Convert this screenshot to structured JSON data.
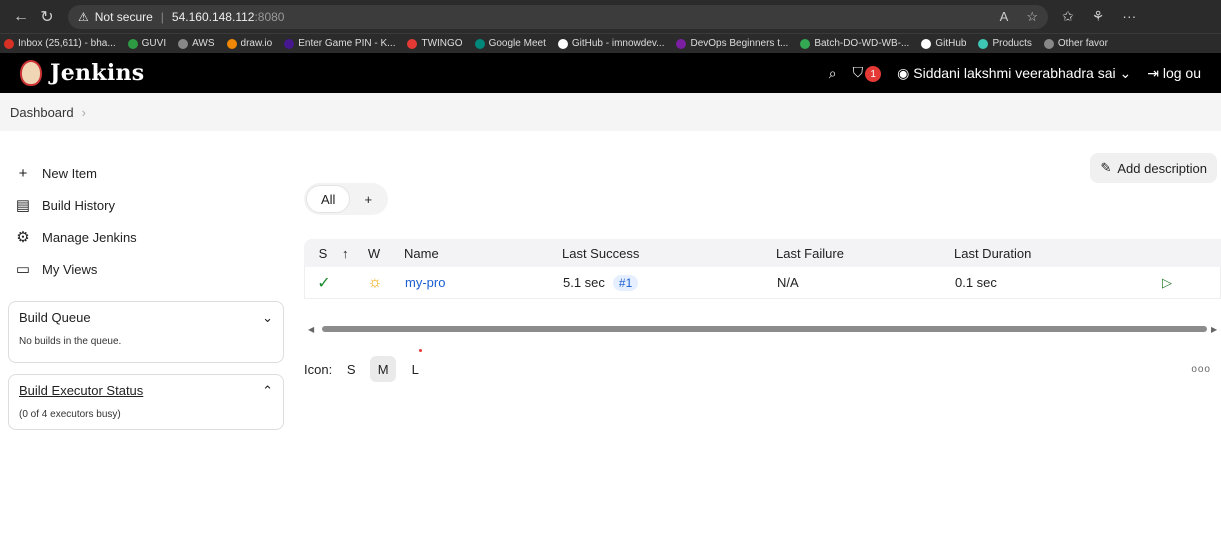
{
  "browser": {
    "warning": "Not secure",
    "url_host": "54.160.148.112",
    "url_port": ":8080"
  },
  "bookmarks": [
    {
      "label": "Inbox (25,611) - bha...",
      "color": "#d93025"
    },
    {
      "label": "GUVI",
      "color": "#2e9b44"
    },
    {
      "label": "AWS",
      "color": "#888888"
    },
    {
      "label": "draw.io",
      "color": "#f08705"
    },
    {
      "label": "Enter Game PIN - K...",
      "color": "#46178f"
    },
    {
      "label": "TWINGO",
      "color": "#e53935"
    },
    {
      "label": "Google Meet",
      "color": "#00897b"
    },
    {
      "label": "GitHub - imnowdev...",
      "color": "#ffffff"
    },
    {
      "label": "DevOps Beginners t...",
      "color": "#7b1fa2"
    },
    {
      "label": "Batch-DO-WD-WB-...",
      "color": "#34a853"
    },
    {
      "label": "GitHub",
      "color": "#ffffff"
    },
    {
      "label": "Products",
      "color": "#3ec6b5"
    },
    {
      "label": "Other favor",
      "color": "#888888"
    }
  ],
  "header": {
    "title": "Jenkins",
    "notification_count": "1",
    "user": "Siddani lakshmi veerabhadra sai",
    "logout": "log ou"
  },
  "breadcrumb": {
    "item": "Dashboard"
  },
  "sidebar": {
    "items": [
      {
        "label": "New Item",
        "icon": "+"
      },
      {
        "label": "Build History",
        "icon": "▤"
      },
      {
        "label": "Manage Jenkins",
        "icon": "⚙"
      },
      {
        "label": "My Views",
        "icon": "▭"
      }
    ],
    "build_queue": {
      "title": "Build Queue",
      "body": "No builds in the queue."
    },
    "executor": {
      "title": "Build Executor Status",
      "body": "(0 of 4 executors busy)"
    }
  },
  "main": {
    "add_description": "Add description",
    "tabs": [
      "All",
      "+"
    ],
    "columns": {
      "s": "S",
      "t": "↑",
      "w": "W",
      "name": "Name",
      "last_success": "Last Success",
      "last_failure": "Last Failure",
      "last_duration": "Last Duration"
    },
    "jobs": [
      {
        "name": "my-pro",
        "last_success": "5.1 sec",
        "build": "#1",
        "last_failure": "N/A",
        "last_duration": "0.1 sec"
      }
    ],
    "icon_label": "Icon:",
    "icon_sizes": [
      "S",
      "M",
      "L"
    ],
    "more": "ooo"
  }
}
